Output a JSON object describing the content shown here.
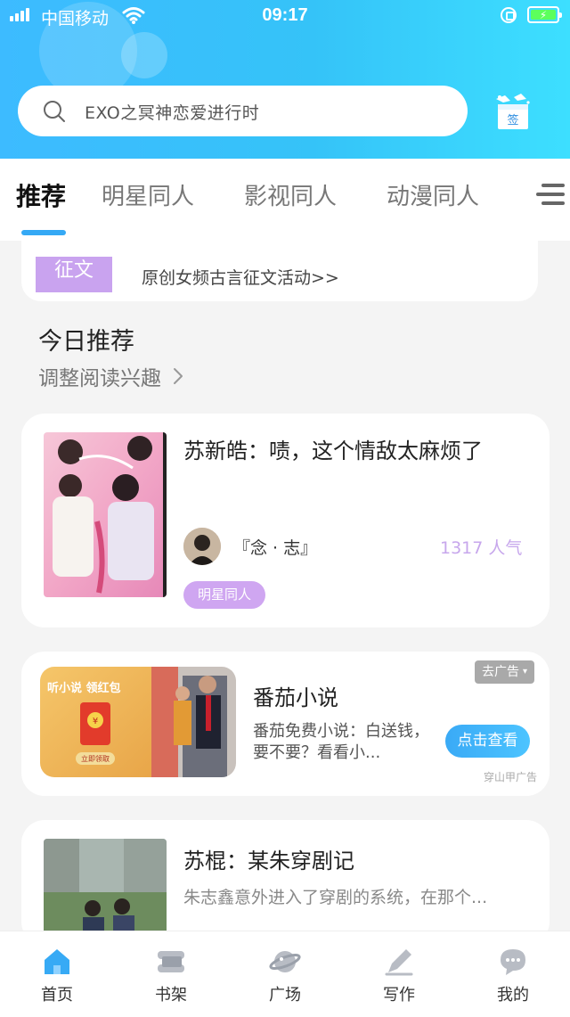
{
  "status_bar": {
    "carrier": "中国移动",
    "time": "09:17"
  },
  "search": {
    "placeholder": "EXO之冥神恋爱进行时",
    "signin_label": "签"
  },
  "tabs": [
    {
      "label": "推荐",
      "active": true
    },
    {
      "label": "明星同人",
      "active": false
    },
    {
      "label": "影视同人",
      "active": false
    },
    {
      "label": "动漫同人",
      "active": false
    }
  ],
  "banner": {
    "badge": "征文",
    "text": "原创女频古言征文活动>>"
  },
  "recommend": {
    "title": "今日推荐",
    "interest_link": "调整阅读兴趣"
  },
  "books": [
    {
      "title": "苏新皓：啧，这个情敌太麻烦了",
      "author": "『念 · 志』",
      "popularity": "1317 人气",
      "tag": "明星同人"
    },
    {
      "title": "苏棍：某朱穿剧记",
      "description": "朱志鑫意外进入了穿剧的系统，在那个..."
    }
  ],
  "ad": {
    "close_label": "去广告",
    "title": "番茄小说",
    "description": "番茄免费小说：白送钱，要不要？看看小...",
    "button": "点击查看",
    "source": "穿山甲广告",
    "image_caption": "听小说 领红包",
    "image_button": "立即领取"
  },
  "bottom_nav": [
    {
      "label": "首页",
      "icon": "home-icon",
      "active": true
    },
    {
      "label": "书架",
      "icon": "bookshelf-icon",
      "active": false
    },
    {
      "label": "广场",
      "icon": "planet-icon",
      "active": false
    },
    {
      "label": "写作",
      "icon": "pen-icon",
      "active": false
    },
    {
      "label": "我的",
      "icon": "chat-icon",
      "active": false
    }
  ],
  "colors": {
    "accent": "#35a9f5",
    "tag_purple": "#cfa6f1",
    "popularity": "#c7a7ec"
  }
}
